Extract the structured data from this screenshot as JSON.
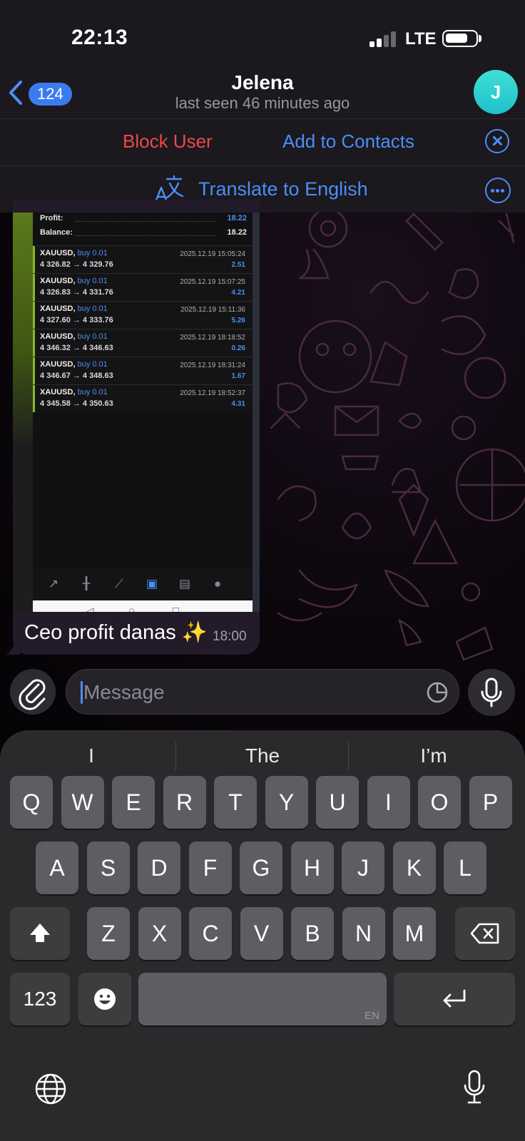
{
  "status_bar": {
    "time": "22:13",
    "network": "LTE"
  },
  "header": {
    "back_badge": "124",
    "contact_name": "Jelena",
    "last_seen": "last seen 46 minutes ago",
    "avatar_letter": "J",
    "avatar_color": "#2fd1cf"
  },
  "actions": {
    "block_user": "Block User",
    "add_to_contacts": "Add to Contacts",
    "translate": "Translate to English"
  },
  "message": {
    "screenshot": {
      "profit_label": "Profit:",
      "profit_value": "18.22",
      "balance_label": "Balance:",
      "balance_value": "18.22",
      "trades": [
        {
          "symbol": "XAUUSD,",
          "side": "buy 0.01",
          "prices": "4 326.82 → 4 329.76",
          "datetime": "2025.12.19 15:05:24",
          "pl": "2.51"
        },
        {
          "symbol": "XAUUSD,",
          "side": "buy 0.01",
          "prices": "4 326.83 → 4 331.76",
          "datetime": "2025.12.19 15:07:25",
          "pl": "4.21"
        },
        {
          "symbol": "XAUUSD,",
          "side": "buy 0.01",
          "prices": "4 327.60 → 4 333.76",
          "datetime": "2025.12.19 15:11:36",
          "pl": "5.26"
        },
        {
          "symbol": "XAUUSD,",
          "side": "buy 0.01",
          "prices": "4 346.32 → 4 346.63",
          "datetime": "2025.12.19 18:18:52",
          "pl": "0.26"
        },
        {
          "symbol": "XAUUSD,",
          "side": "buy 0.01",
          "prices": "4 346.67 → 4 348.63",
          "datetime": "2025.12.19 18:31:24",
          "pl": "1.67"
        },
        {
          "symbol": "XAUUSD,",
          "side": "buy 0.01",
          "prices": "4 345.58 → 4 350.63",
          "datetime": "2025.12.19 18:52:37",
          "pl": "4.31"
        }
      ]
    },
    "text": "Ceo profit danas ✨",
    "time": "18:00"
  },
  "composer": {
    "placeholder": "Message"
  },
  "keyboard": {
    "suggestions": [
      "I",
      "The",
      "I’m"
    ],
    "row1": [
      "Q",
      "W",
      "E",
      "R",
      "T",
      "Y",
      "U",
      "I",
      "O",
      "P"
    ],
    "row2": [
      "A",
      "S",
      "D",
      "F",
      "G",
      "H",
      "J",
      "K",
      "L"
    ],
    "row3": [
      "Z",
      "X",
      "C",
      "V",
      "B",
      "N",
      "M"
    ],
    "numbers_key": "123",
    "space_lang": "EN"
  },
  "icons": {
    "attach": "paperclip-icon",
    "mic": "microphone-icon",
    "sticker": "sticker-icon",
    "shift": "shift-icon",
    "delete": "backspace-icon",
    "return": "return-icon",
    "emoji": "emoji-icon",
    "globe": "globe-icon",
    "dictation": "dictation-icon"
  },
  "colors": {
    "accent": "#4a8ff5",
    "danger": "#ea4a4a",
    "bubble": "#231b2a",
    "profit": "#4a8ff5"
  }
}
